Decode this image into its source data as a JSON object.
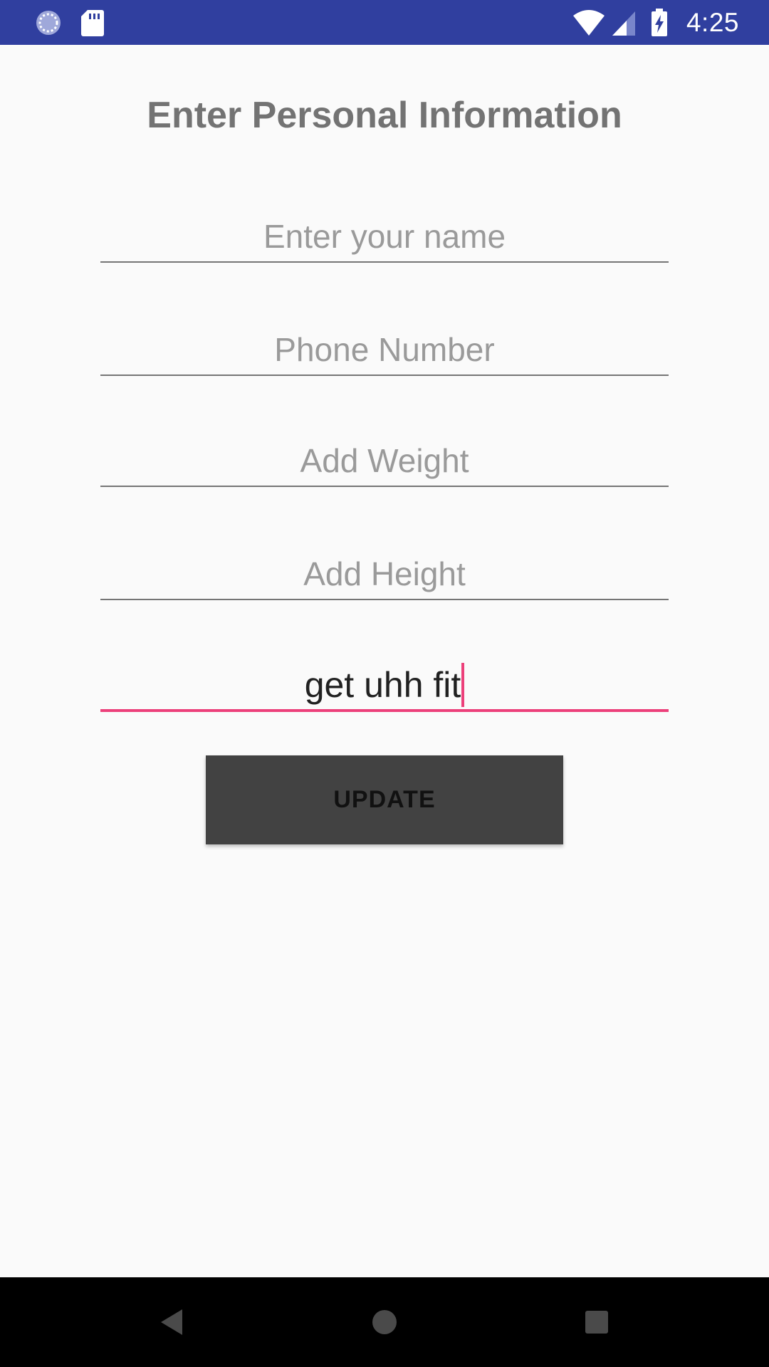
{
  "status_bar": {
    "time": "4:25",
    "left_icons": [
      "sync-icon",
      "sd-card-icon"
    ],
    "right_icons": [
      "wifi-icon",
      "cell-signal-icon",
      "battery-charging-icon"
    ]
  },
  "page": {
    "title": "Enter Personal Information"
  },
  "form": {
    "name": {
      "placeholder": "Enter your name",
      "value": ""
    },
    "phone": {
      "placeholder": "Phone Number",
      "value": ""
    },
    "weight": {
      "placeholder": "Add Weight",
      "value": ""
    },
    "height": {
      "placeholder": "Add Height",
      "value": ""
    },
    "goal": {
      "value": "get uhh fit"
    },
    "update_label": "UPDATE"
  },
  "nav_bar": {
    "buttons": [
      "back-icon",
      "home-icon",
      "recents-icon"
    ]
  },
  "colors": {
    "status_bar": "#303f9f",
    "accent": "#ec407a",
    "button": "#424242",
    "title_text": "#737373"
  }
}
